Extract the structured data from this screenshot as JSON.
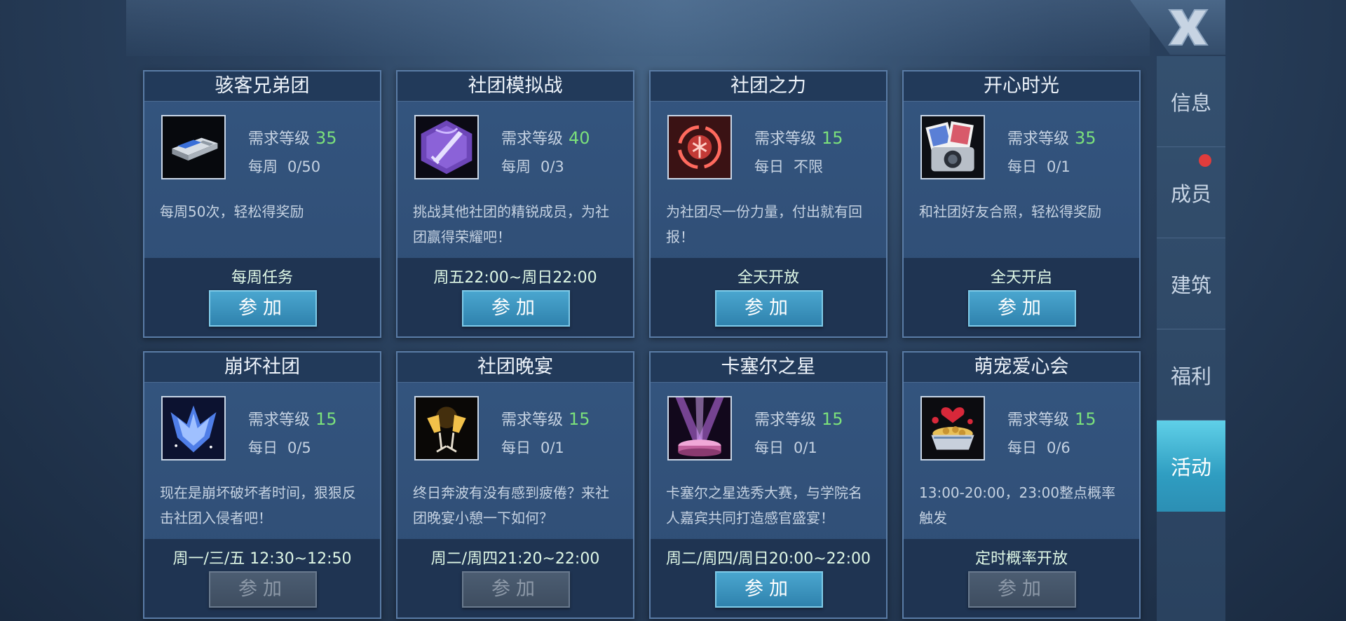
{
  "close_label": "X",
  "sidebar": {
    "items": [
      {
        "label": "信息",
        "active": false,
        "badge": false
      },
      {
        "label": "成员",
        "active": false,
        "badge": true
      },
      {
        "label": "建筑",
        "active": false,
        "badge": false
      },
      {
        "label": "福利",
        "active": false,
        "badge": false
      },
      {
        "label": "活动",
        "active": true,
        "badge": false
      }
    ]
  },
  "req_label": "需求等级",
  "join_label": "参加",
  "cards": [
    {
      "title": "骇客兄弟团",
      "level": "35",
      "period": "每周",
      "count": "0/50",
      "desc": "每周50次，轻松得奖励",
      "time": "每周任务",
      "icon": "usb-drive-icon",
      "enabled": true
    },
    {
      "title": "社团模拟战",
      "level": "40",
      "period": "每周",
      "count": "0/3",
      "desc": "挑战其他社团的精锐成员，为社团赢得荣耀吧！",
      "time": "周五22:00~周日22:00",
      "icon": "sword-emblem-icon",
      "enabled": true
    },
    {
      "title": "社团之力",
      "level": "15",
      "period": "每日",
      "count": "不限",
      "desc": "为社团尽一份力量，付出就有回报！",
      "time": "全天开放",
      "icon": "red-sigil-icon",
      "enabled": true
    },
    {
      "title": "开心时光",
      "level": "35",
      "period": "每日",
      "count": "0/1",
      "desc": "和社团好友合照，轻松得奖励",
      "time": "全天开启",
      "icon": "camera-icon",
      "enabled": true
    },
    {
      "title": "崩坏社团",
      "level": "15",
      "period": "每日",
      "count": "0/5",
      "desc": "现在是崩坏破坏者时间，狠狠反击社团入侵者吧！",
      "time": "周一/三/五 12:30~12:50",
      "icon": "crystal-crest-icon",
      "enabled": false
    },
    {
      "title": "社团晚宴",
      "level": "15",
      "period": "每日",
      "count": "0/1",
      "desc": "终日奔波有没有感到疲倦？来社团晚宴小憩一下如何？",
      "time": "周二/周四21:20~22:00",
      "icon": "champagne-icon",
      "enabled": false
    },
    {
      "title": "卡塞尔之星",
      "level": "15",
      "period": "每日",
      "count": "0/1",
      "desc": "卡塞尔之星选秀大赛，与学院名人嘉宾共同打造感官盛宴！",
      "time": "周二/周四/周日20:00~22:00",
      "icon": "stage-spotlight-icon",
      "enabled": true
    },
    {
      "title": "萌宠爱心会",
      "level": "15",
      "period": "每日",
      "count": "0/6",
      "desc": "13:00-20:00，23:00整点概率触发",
      "time": "定时概率开放",
      "icon": "pet-bowl-icon",
      "enabled": false
    }
  ]
}
